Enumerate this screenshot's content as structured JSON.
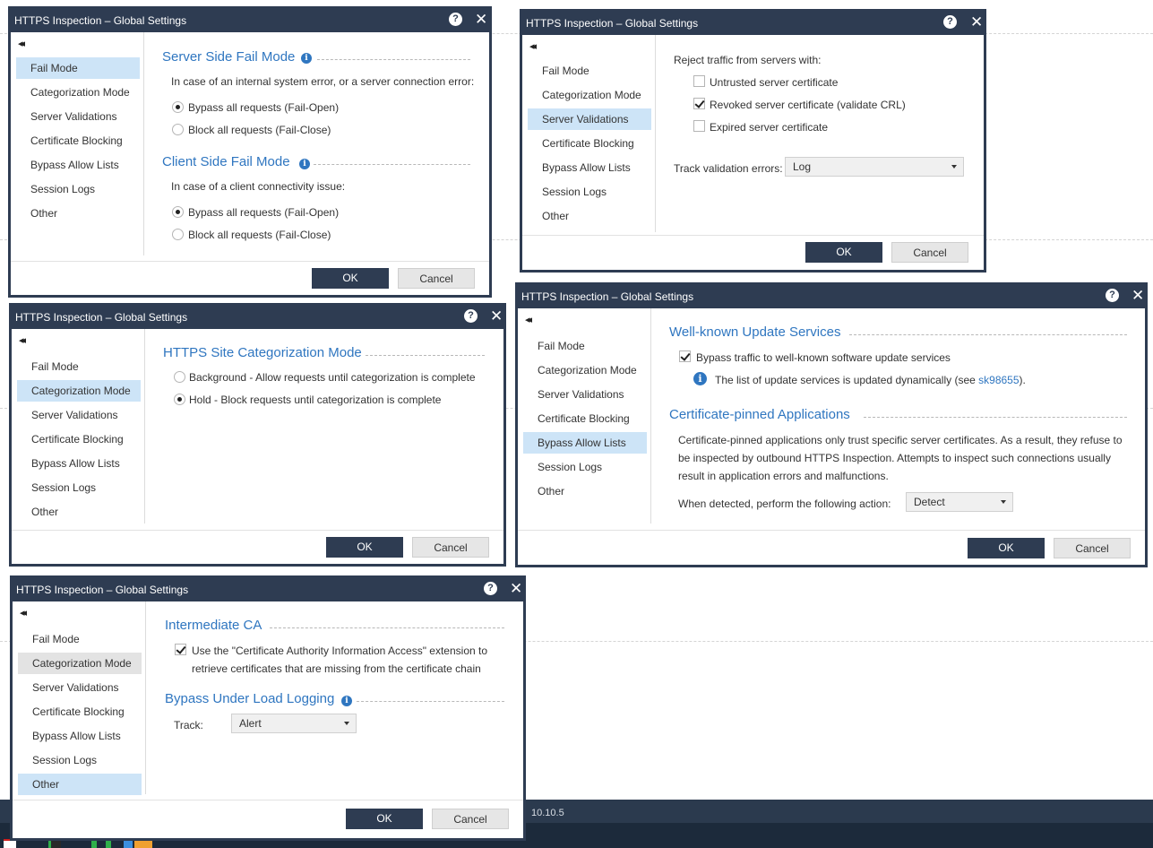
{
  "dialog_title": "HTTPS Inspection – Global Settings",
  "help_symbol": "?",
  "close_symbol": "✕",
  "collapse_symbol": "◂◂",
  "nav": {
    "fail_mode": "Fail Mode",
    "categorization_mode": "Categorization Mode",
    "server_validations": "Server Validations",
    "certificate_blocking": "Certificate Blocking",
    "bypass_allow_lists": "Bypass Allow Lists",
    "session_logs": "Session Logs",
    "other": "Other"
  },
  "buttons": {
    "ok": "OK",
    "cancel": "Cancel"
  },
  "fail_mode": {
    "server_title": "Server Side Fail Mode",
    "server_desc": "In case of an internal system error, or a server connection error:",
    "server_options": [
      "Bypass all requests (Fail-Open)",
      "Block all requests (Fail-Close)"
    ],
    "server_selected": 0,
    "client_title": "Client Side Fail Mode",
    "client_desc": "In case of a client connectivity issue:",
    "client_options": [
      "Bypass all requests (Fail-Open)",
      "Block all requests (Fail-Close)"
    ],
    "client_selected": 0
  },
  "categorization": {
    "title": "HTTPS Site Categorization Mode",
    "options": [
      "Background - Allow requests until categorization is complete",
      "Hold - Block requests until categorization is complete"
    ],
    "selected": 1
  },
  "server_validations": {
    "reject_label": "Reject traffic from servers with:",
    "untrusted": {
      "label": "Untrusted server certificate",
      "checked": false
    },
    "revoked": {
      "label": "Revoked server certificate (validate CRL)",
      "checked": true
    },
    "expired": {
      "label": "Expired server certificate",
      "checked": false
    },
    "track_label": "Track validation errors:",
    "track_value": "Log"
  },
  "bypass": {
    "updates_title": "Well-known Update Services",
    "updates_checkbox": {
      "label": "Bypass traffic to well-known software update services",
      "checked": true
    },
    "updates_note_prefix": "The list of update services is updated dynamically (see ",
    "updates_note_link": "sk98655",
    "updates_note_suffix": ").",
    "pinned_title": "Certificate-pinned Applications",
    "pinned_desc_1": "Certificate-pinned applications only trust specific server certificates. As a result, they refuse to",
    "pinned_desc_2": "be inspected by outbound HTTPS Inspection. Attempts to inspect such connections usually",
    "pinned_desc_3": "result in application errors and malfunctions.",
    "action_label": "When detected, perform the following action:",
    "action_value": "Detect"
  },
  "other": {
    "ca_title": "Intermediate CA",
    "ca_checkbox_1": "Use the \"Certificate Authority Information Access\" extension to",
    "ca_checkbox_2": "retrieve certificates that are missing from the certificate chain",
    "ca_checked": true,
    "load_title": "Bypass Under Load Logging",
    "track_label": "Track:",
    "track_value": "Alert"
  },
  "taskbar": {
    "version_text": "10.10.5"
  },
  "colors": {
    "titlebar": "#2e3c52",
    "accent": "#2f76c0",
    "nav_selected": "#cde4f7",
    "primary_button": "#2e3c52"
  }
}
